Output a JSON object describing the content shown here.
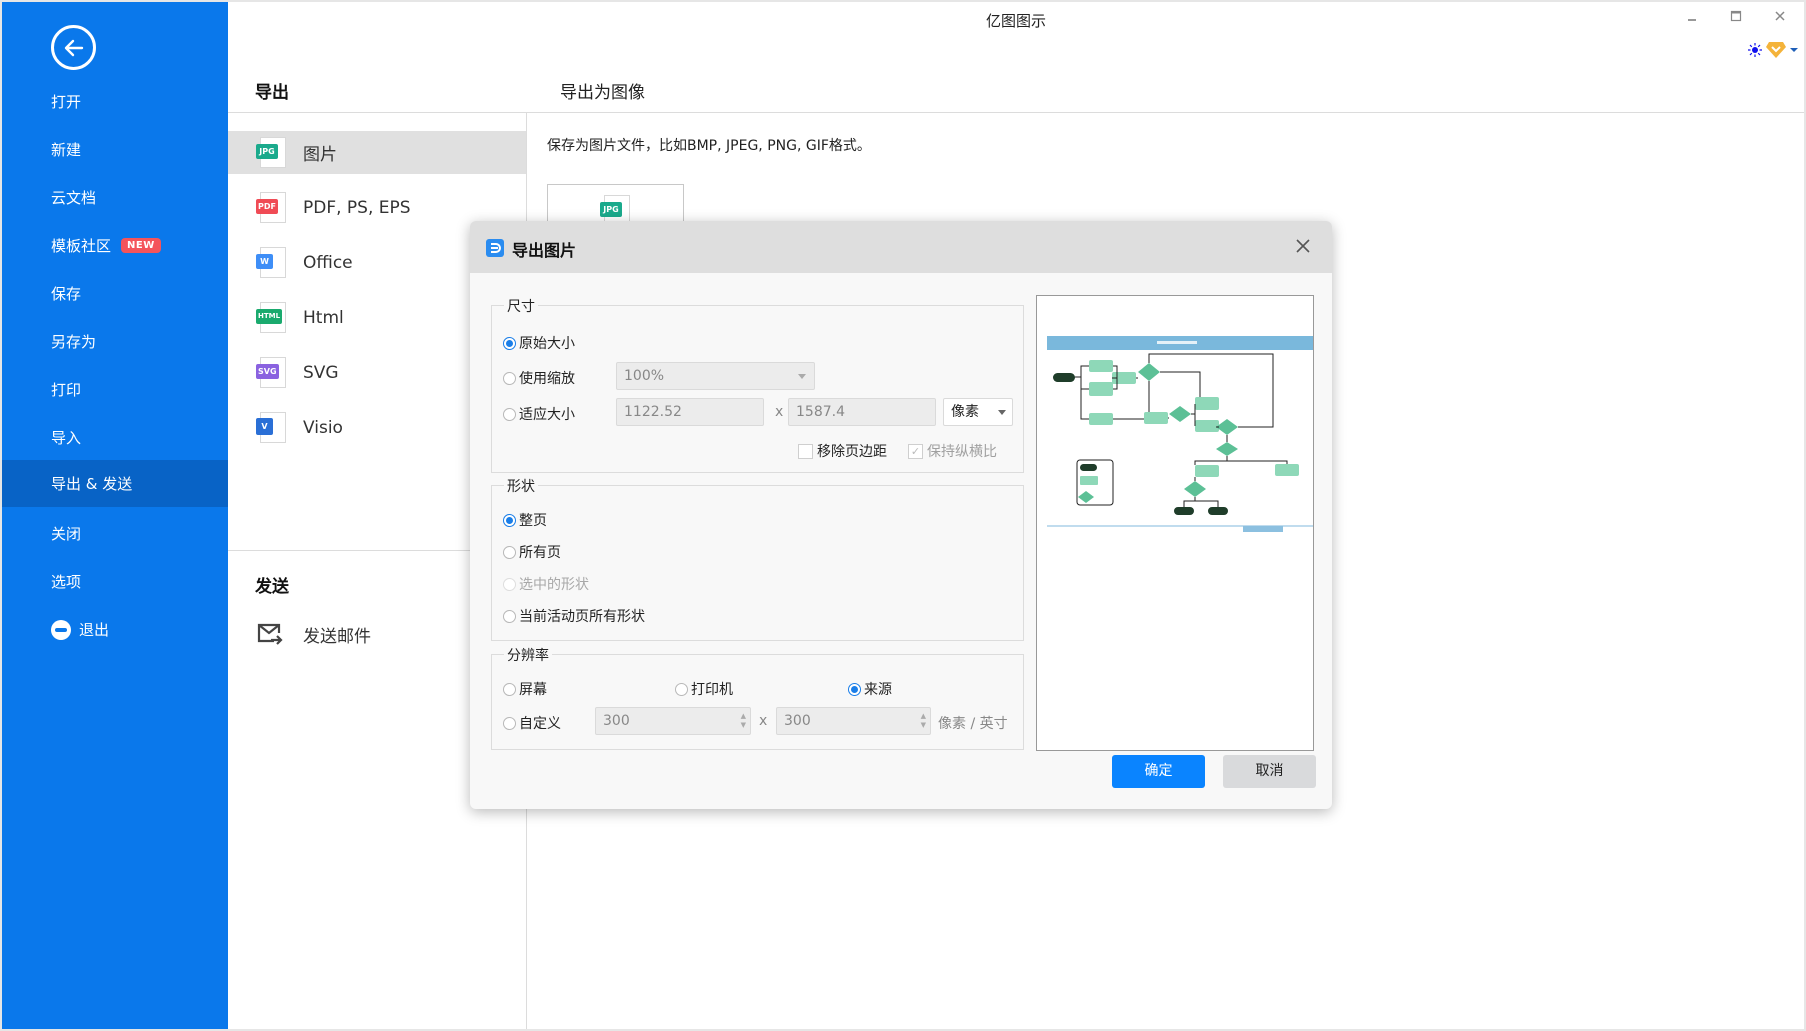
{
  "window": {
    "title": "亿图图示",
    "minimize_icon": "minimize-icon",
    "maximize_icon": "maximize-icon",
    "close_icon": "close-icon"
  },
  "sidebar": {
    "back_icon": "arrow-left-circle-icon",
    "items": [
      {
        "label": "打开"
      },
      {
        "label": "新建"
      },
      {
        "label": "云文档"
      },
      {
        "label": "模板社区",
        "badge": "NEW"
      },
      {
        "label": "保存"
      },
      {
        "label": "另存为"
      },
      {
        "label": "打印"
      },
      {
        "label": "导入"
      },
      {
        "label": "导出 & 发送",
        "active": true
      },
      {
        "label": "关闭"
      },
      {
        "label": "选项"
      },
      {
        "label": "退出",
        "icon": "minus-circle-icon"
      }
    ]
  },
  "export_panel": {
    "title": "导出",
    "formats": [
      {
        "tag": "JPG",
        "label": "图片",
        "color": "#1aaa8c",
        "active": true
      },
      {
        "tag": "PDF",
        "label": "PDF, PS, EPS",
        "color": "#f04b55"
      },
      {
        "tag": "W",
        "label": "Office",
        "color": "#3e8ef7"
      },
      {
        "tag": "HTML",
        "label": "Html",
        "color": "#1aaa6e"
      },
      {
        "tag": "SVG",
        "label": "SVG",
        "color": "#8a62e0"
      },
      {
        "tag": "V",
        "label": "Visio",
        "color": "#2a6fd6"
      }
    ],
    "send_title": "发送",
    "send_items": [
      {
        "label": "发送邮件",
        "icon": "mail-send-icon"
      }
    ]
  },
  "detail": {
    "title": "导出为图像",
    "description": "保存为图片文件，比如BMP, JPEG, PNG, GIF格式。",
    "thumb_tag": "JPG"
  },
  "dialog": {
    "title": "导出图片",
    "size": {
      "legend": "尺寸",
      "original": "原始大小",
      "use_scale": "使用缩放",
      "scale_value": "100%",
      "fit_size": "适应大小",
      "width": "1122.52",
      "times": "x",
      "height": "1587.4",
      "unit": "像素",
      "remove_margin": "移除页边距",
      "remove_margin_checked": false,
      "keep_ratio": "保持纵横比",
      "keep_ratio_checked": true,
      "selected": "original"
    },
    "shape": {
      "legend": "形状",
      "options": [
        {
          "label": "整页",
          "checked": true
        },
        {
          "label": "所有页"
        },
        {
          "label": "选中的形状",
          "disabled": true
        },
        {
          "label": "当前活动页所有形状"
        }
      ]
    },
    "resolution": {
      "legend": "分辨率",
      "screen": "屏幕",
      "printer": "打印机",
      "source": "来源",
      "custom": "自定义",
      "dpi_x": "300",
      "times": "x",
      "dpi_y": "300",
      "unit": "像素 / 英寸",
      "selected": "source"
    },
    "ok": "确定",
    "cancel": "取消"
  },
  "colors": {
    "sidebar": "#0a78eb",
    "sidebar_active": "#0863c6",
    "primary_button": "#0a84ff",
    "preview_header": "#7ab8dc",
    "preview_node": "#8ed8b8",
    "preview_dark": "#1f3d2a"
  }
}
